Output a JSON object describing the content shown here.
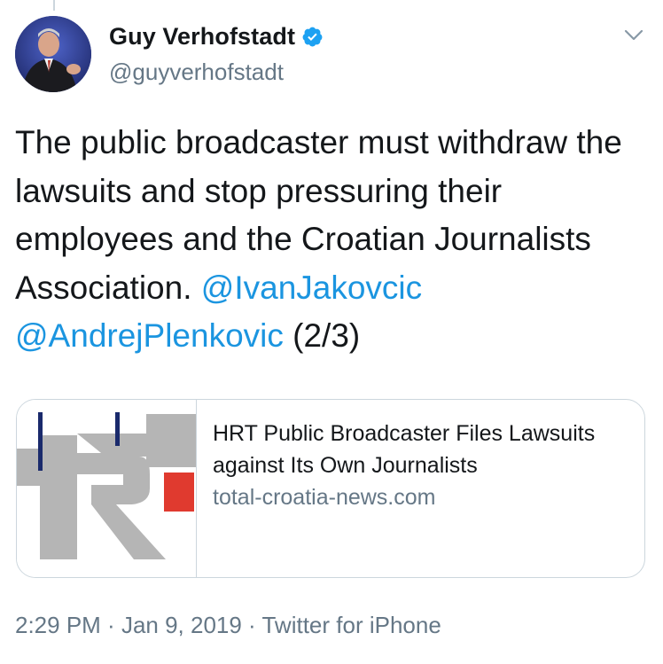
{
  "author": {
    "display_name": "Guy Verhofstadt",
    "handle": "@guyverhofstadt",
    "verified": true
  },
  "tweet": {
    "text_part1": "The public broadcaster must withdraw the lawsuits and stop pressuring their employees and the Croatian Journalists Association. ",
    "mention1": "@IvanJakovcic",
    "mention2": "@AndrejPlenkovic",
    "text_part2": " (2/3)"
  },
  "card": {
    "title": "HRT Public Broadcaster Files Lawsuits against Its Own Journalists",
    "domain": "total-croatia-news.com",
    "image_icon": "hrt-logo"
  },
  "meta": {
    "time": "2:29 PM",
    "separator": " · ",
    "date": "Jan 9, 2019",
    "source": "Twitter for iPhone"
  },
  "colors": {
    "link": "#1b95e0",
    "secondary_text": "#657786",
    "border": "#ccd6dd",
    "verified": "#1da1f2",
    "logo_red": "#e03a2f",
    "logo_navy": "#1a2a6c",
    "logo_gray": "#b5b5b5"
  }
}
